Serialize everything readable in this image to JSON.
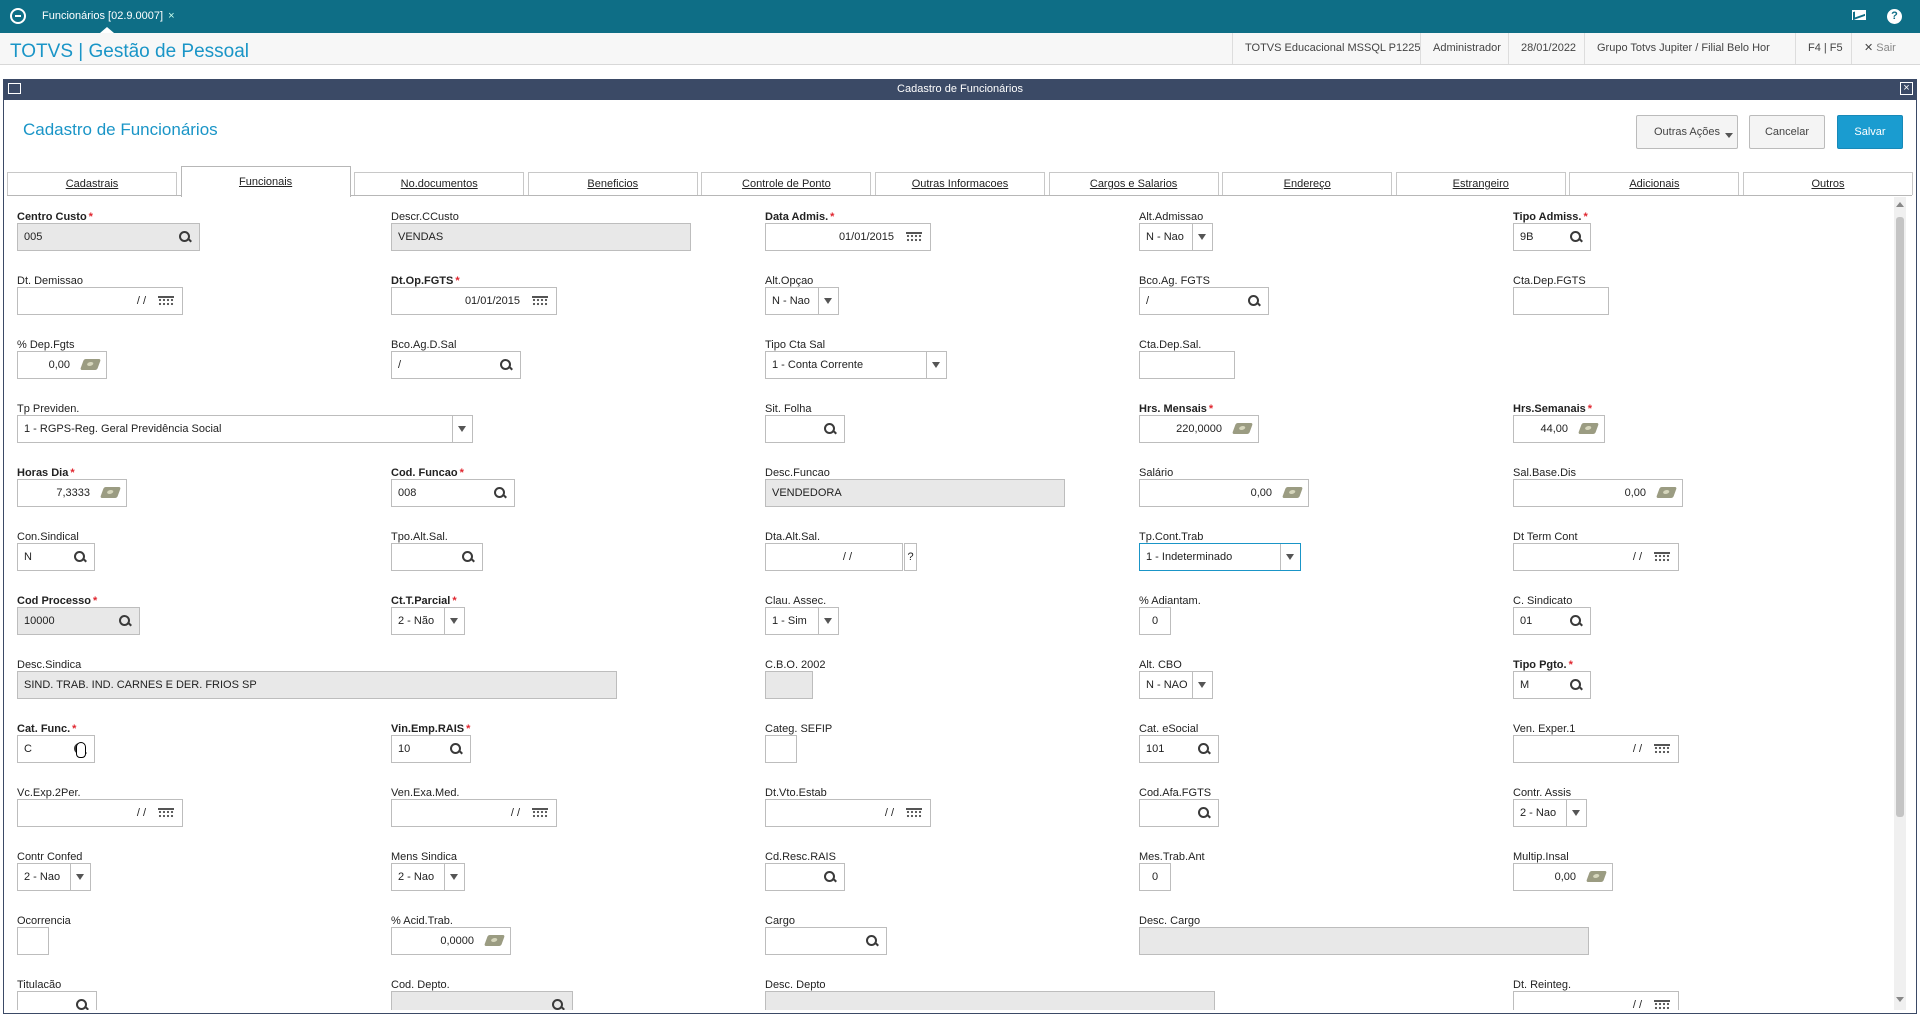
{
  "topbar": {
    "tab_label": "Funcionários [02.9.0007]",
    "tab_close": "×"
  },
  "header": {
    "app_title": "TOTVS | Gestão de Pessoal",
    "environment": "TOTVS Educacional MSSQL P1225",
    "user": "Administrador",
    "date": "28/01/2022",
    "company": "Grupo Totvs Jupiter / Filial Belo Hor",
    "shortcuts": "F4 | F5",
    "exit": "Sair",
    "exit_glyph": "✕"
  },
  "window": {
    "title": "Cadastro de Funcionários",
    "close": "×"
  },
  "page": {
    "title": "Cadastro de Funcionários"
  },
  "actions": {
    "outras": "Outras Ações",
    "cancelar": "Cancelar",
    "salvar": "Salvar"
  },
  "tabs": [
    {
      "label": "Cadastrais",
      "active": false
    },
    {
      "label": "Funcionais",
      "active": true
    },
    {
      "label": "No.documentos",
      "active": false
    },
    {
      "label": "Beneficios",
      "active": false
    },
    {
      "label": "Controle de Ponto",
      "active": false
    },
    {
      "label": "Outras Informacoes",
      "active": false
    },
    {
      "label": "Cargos e Salarios",
      "active": false
    },
    {
      "label": "Endereço",
      "active": false
    },
    {
      "label": "Estrangeiro",
      "active": false
    },
    {
      "label": "Adicionais",
      "active": false
    },
    {
      "label": "Outros",
      "active": false
    }
  ],
  "fields": [
    {
      "name": "centro-custo",
      "label": "Centro Custo",
      "req": true,
      "value": "005",
      "icon": "mag",
      "ro": true
    },
    {
      "name": "descr-ccusto",
      "label": "Descr.CCusto",
      "req": false,
      "value": "VENDAS",
      "icon": "",
      "ro": true
    },
    {
      "name": "data-admis",
      "label": "Data Admis.",
      "req": true,
      "value": "01/01/2015",
      "icon": "cal",
      "ro": false
    },
    {
      "name": "alt-admissao",
      "label": "Alt.Admissao",
      "req": false,
      "value": "N - Nao",
      "icon": "caret",
      "ro": false
    },
    {
      "name": "tipo-admiss",
      "label": "Tipo Admiss.",
      "req": true,
      "value": "9B",
      "icon": "mag",
      "ro": false
    },
    {
      "name": "dt-demissao",
      "label": "Dt. Demissao",
      "req": false,
      "value": "/ /",
      "icon": "cal",
      "ro": false
    },
    {
      "name": "dt-op-fgts",
      "label": "Dt.Op.FGTS",
      "req": true,
      "value": "01/01/2015",
      "icon": "cal",
      "ro": false
    },
    {
      "name": "alt-opcao",
      "label": "Alt.Opçao",
      "req": false,
      "value": "N - Nao",
      "icon": "caret",
      "ro": false
    },
    {
      "name": "bco-ag-fgts",
      "label": "Bco.Ag. FGTS",
      "req": false,
      "value": "/",
      "icon": "mag",
      "ro": false
    },
    {
      "name": "cta-dep-fgts",
      "label": "Cta.Dep.FGTS",
      "req": false,
      "value": "",
      "icon": "",
      "ro": false
    },
    {
      "name": "dep-fgts",
      "label": "% Dep.Fgts",
      "req": false,
      "value": "0,00",
      "icon": "money",
      "ro": false
    },
    {
      "name": "bco-ag-d-sal",
      "label": "Bco.Ag.D.Sal",
      "req": false,
      "value": "/",
      "icon": "mag",
      "ro": false
    },
    {
      "name": "tipo-cta-sal",
      "label": "Tipo Cta Sal",
      "req": false,
      "value": "1 - Conta Corrente",
      "icon": "caret",
      "ro": false
    },
    {
      "name": "cta-dep-sal",
      "label": "Cta.Dep.Sal.",
      "req": false,
      "value": "",
      "icon": "",
      "ro": false
    },
    {
      "name": "tp-previden",
      "label": "Tp Previden.",
      "req": false,
      "value": "1 - RGPS-Reg. Geral Previdência Social",
      "icon": "caret",
      "ro": false
    },
    {
      "name": "sit-folha",
      "label": "Sit. Folha",
      "req": false,
      "value": "",
      "icon": "mag",
      "ro": false
    },
    {
      "name": "hrs-mensais",
      "label": "Hrs. Mensais",
      "req": true,
      "value": "220,0000",
      "icon": "money",
      "ro": false
    },
    {
      "name": "hrs-semanais",
      "label": "Hrs.Semanais",
      "req": true,
      "value": "44,00",
      "icon": "money",
      "ro": false
    },
    {
      "name": "horas-dia",
      "label": "Horas Dia",
      "req": true,
      "value": "7,3333",
      "icon": "money",
      "ro": false
    },
    {
      "name": "cod-funcao",
      "label": "Cod. Funcao",
      "req": true,
      "value": "008",
      "icon": "mag",
      "ro": false
    },
    {
      "name": "desc-funcao",
      "label": "Desc.Funcao",
      "req": false,
      "value": "VENDEDORA",
      "icon": "",
      "ro": true
    },
    {
      "name": "salario",
      "label": "Salário",
      "req": false,
      "value": "0,00",
      "icon": "money",
      "ro": false
    },
    {
      "name": "sal-base-dis",
      "label": "Sal.Base.Dis",
      "req": false,
      "value": "0,00",
      "icon": "money",
      "ro": false
    },
    {
      "name": "con-sindical",
      "label": "Con.Sindical",
      "req": false,
      "value": "N",
      "icon": "mag",
      "ro": false
    },
    {
      "name": "tpo-alt-sal",
      "label": "Tpo.Alt.Sal.",
      "req": false,
      "value": "",
      "icon": "mag",
      "ro": false
    },
    {
      "name": "dta-alt-sal",
      "label": "Dta.Alt.Sal.",
      "req": false,
      "value": "/ /",
      "icon": "",
      "ro": false
    },
    {
      "name": "tp-cont-trab",
      "label": "Tp.Cont.Trab",
      "req": false,
      "value": "1 - Indeterminado",
      "icon": "caret",
      "ro": false
    },
    {
      "name": "dt-term-cont",
      "label": "Dt Term Cont",
      "req": false,
      "value": "/ /",
      "icon": "cal",
      "ro": false
    },
    {
      "name": "cod-processo",
      "label": "Cod Processo",
      "req": true,
      "value": "10000",
      "icon": "mag",
      "ro": true
    },
    {
      "name": "ct-t-parcial",
      "label": "Ct.T.Parcial",
      "req": true,
      "value": "2 - Não",
      "icon": "caret",
      "ro": false
    },
    {
      "name": "clau-assec",
      "label": "Clau. Assec.",
      "req": false,
      "value": "1 - Sim",
      "icon": "caret",
      "ro": false
    },
    {
      "name": "adiantam",
      "label": "% Adiantam.",
      "req": false,
      "value": "0",
      "icon": "",
      "ro": false
    },
    {
      "name": "c-sindicato",
      "label": "C. Sindicato",
      "req": false,
      "value": "01",
      "icon": "mag",
      "ro": false
    },
    {
      "name": "desc-sindica",
      "label": "Desc.Sindica",
      "req": false,
      "value": "SIND. TRAB. IND. CARNES E DER. FRIOS SP",
      "icon": "",
      "ro": true
    },
    {
      "name": "cbo-2002",
      "label": "C.B.O. 2002",
      "req": false,
      "value": "",
      "icon": "",
      "ro": true
    },
    {
      "name": "alt-cbo",
      "label": "Alt. CBO",
      "req": false,
      "value": "N - NAO",
      "icon": "caret",
      "ro": false
    },
    {
      "name": "tipo-pgto",
      "label": "Tipo Pgto.",
      "req": true,
      "value": "M",
      "icon": "mag",
      "ro": false
    },
    {
      "name": "cat-func",
      "label": "Cat. Func.",
      "req": true,
      "value": "C",
      "icon": "mag",
      "ro": false
    },
    {
      "name": "vin-emp-rais",
      "label": "Vin.Emp.RAIS",
      "req": true,
      "value": "10",
      "icon": "mag",
      "ro": false
    },
    {
      "name": "categ-sefip",
      "label": "Categ. SEFIP",
      "req": false,
      "value": "",
      "icon": "",
      "ro": false
    },
    {
      "name": "cat-esocial",
      "label": "Cat. eSocial",
      "req": false,
      "value": "101",
      "icon": "mag",
      "ro": false
    },
    {
      "name": "ven-exper-1",
      "label": "Ven. Exper.1",
      "req": false,
      "value": "/ /",
      "icon": "cal",
      "ro": false
    },
    {
      "name": "vc-exp-2per",
      "label": "Vc.Exp.2Per.",
      "req": false,
      "value": "/ /",
      "icon": "cal",
      "ro": false
    },
    {
      "name": "ven-exa-med",
      "label": "Ven.Exa.Med.",
      "req": false,
      "value": "/ /",
      "icon": "cal",
      "ro": false
    },
    {
      "name": "dt-vto-estab",
      "label": "Dt.Vto.Estab",
      "req": false,
      "value": "/ /",
      "icon": "cal",
      "ro": false
    },
    {
      "name": "cod-afa-fgts",
      "label": "Cod.Afa.FGTS",
      "req": false,
      "value": "",
      "icon": "mag",
      "ro": false
    },
    {
      "name": "contr-assis",
      "label": "Contr. Assis",
      "req": false,
      "value": "2 - Nao",
      "icon": "caret",
      "ro": false
    },
    {
      "name": "contr-confed",
      "label": "Contr Confed",
      "req": false,
      "value": "2 - Nao",
      "icon": "caret",
      "ro": false
    },
    {
      "name": "mens-sindica",
      "label": "Mens Sindica",
      "req": false,
      "value": "2 - Nao",
      "icon": "caret",
      "ro": false
    },
    {
      "name": "cd-resc-rais",
      "label": "Cd.Resc.RAIS",
      "req": false,
      "value": "",
      "icon": "mag",
      "ro": false
    },
    {
      "name": "mes-trab-ant",
      "label": "Mes.Trab.Ant",
      "req": false,
      "value": "0",
      "icon": "",
      "ro": false
    },
    {
      "name": "multip-insal",
      "label": "Multip.Insal",
      "req": false,
      "value": "0,00",
      "icon": "money",
      "ro": false
    },
    {
      "name": "ocorrencia",
      "label": "Ocorrencia",
      "req": false,
      "value": "",
      "icon": "",
      "ro": false
    },
    {
      "name": "acid-trab",
      "label": "% Acid.Trab.",
      "req": false,
      "value": "0,0000",
      "icon": "money",
      "ro": false
    },
    {
      "name": "cargo",
      "label": "Cargo",
      "req": false,
      "value": "",
      "icon": "mag",
      "ro": false
    },
    {
      "name": "desc-cargo",
      "label": "Desc. Cargo",
      "req": false,
      "value": "",
      "icon": "",
      "ro": true
    },
    {
      "name": "titulacao",
      "label": "Titulacão",
      "req": false,
      "value": "",
      "icon": "mag",
      "ro": false
    },
    {
      "name": "cod-depto",
      "label": "Cod. Depto.",
      "req": false,
      "value": "",
      "icon": "mag",
      "ro": true
    },
    {
      "name": "desc-depto",
      "label": "Desc. Depto",
      "req": false,
      "value": "",
      "icon": "",
      "ro": true
    },
    {
      "name": "dt-reinteg",
      "label": "Dt. Reinteg.",
      "req": false,
      "value": "/ /",
      "icon": "cal",
      "ro": false
    }
  ]
}
